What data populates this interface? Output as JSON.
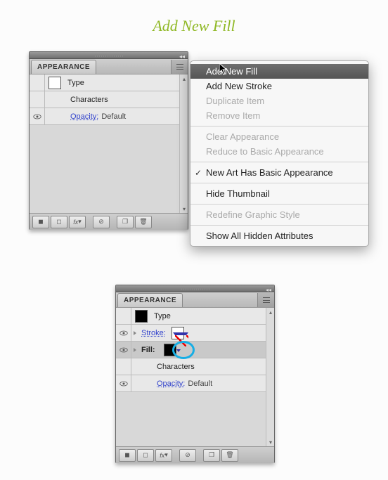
{
  "title": "Add New Fill",
  "panel_top": {
    "tab": "APPEARANCE",
    "rows": {
      "type_label": "Type",
      "characters_label": "Characters",
      "opacity_label": "Opacity:",
      "opacity_value": "Default"
    }
  },
  "panel_bottom": {
    "tab": "APPEARANCE",
    "rows": {
      "type_label": "Type",
      "stroke_label": "Stroke:",
      "fill_label": "Fill:",
      "characters_label": "Characters",
      "opacity_label": "Opacity:",
      "opacity_value": "Default"
    }
  },
  "menu": {
    "items": [
      {
        "label": "Add New Fill",
        "state": "highlighted"
      },
      {
        "label": "Add New Stroke",
        "state": "enabled"
      },
      {
        "label": "Duplicate Item",
        "state": "disabled"
      },
      {
        "label": "Remove Item",
        "state": "disabled"
      },
      "sep",
      {
        "label": "Clear Appearance",
        "state": "disabled"
      },
      {
        "label": "Reduce to Basic Appearance",
        "state": "disabled"
      },
      "sep",
      {
        "label": "New Art Has Basic Appearance",
        "state": "checked"
      },
      "sep",
      {
        "label": "Hide Thumbnail",
        "state": "enabled"
      },
      "sep",
      {
        "label": "Redefine Graphic Style",
        "state": "disabled"
      },
      "sep",
      {
        "label": "Show All Hidden Attributes",
        "state": "enabled"
      }
    ]
  },
  "footer_icons": [
    "new-fill",
    "new-stroke",
    "fx",
    "clear",
    "duplicate",
    "trash"
  ]
}
